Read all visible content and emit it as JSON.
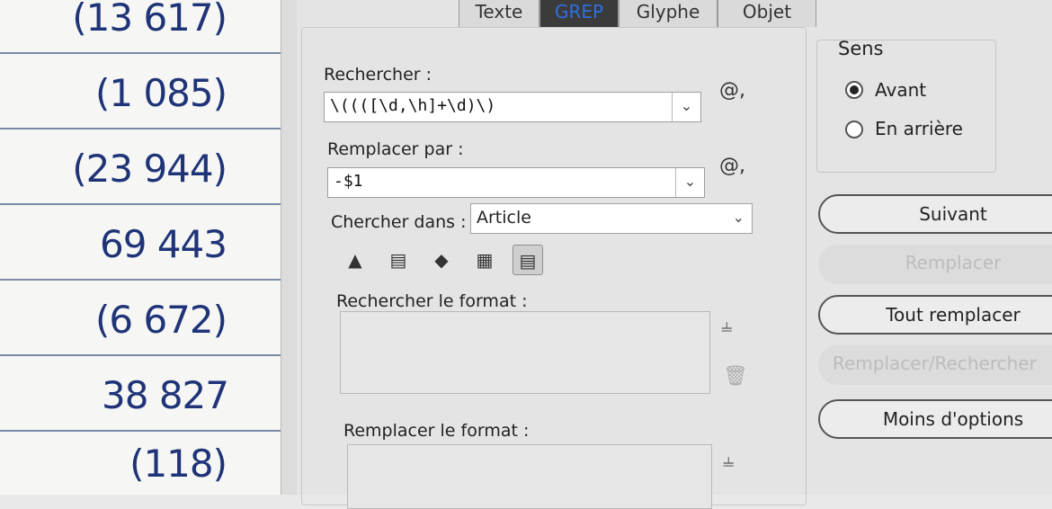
{
  "document": {
    "values": [
      "(13 617)",
      "(1 085)",
      "(23 944)",
      "69 443",
      "(6 672)",
      "38 827",
      "(118)"
    ]
  },
  "tabs": [
    "Texte",
    "GREP",
    "Glyphe",
    "Objet"
  ],
  "active_tab": "GREP",
  "find": {
    "label": "Rechercher :",
    "value": "\\((([\\d,\\h]+\\d)\\)",
    "special_char_icon": "@,"
  },
  "replace": {
    "label": "Remplacer par :",
    "value": "-$1",
    "special_char_icon": "@,"
  },
  "search_in": {
    "label": "Chercher dans :",
    "value": "Article"
  },
  "option_icons": [
    "locked-layers-icon",
    "locked-stories-icon",
    "hidden-layers-icon",
    "master-pages-icon",
    "footnotes-icon"
  ],
  "find_format": {
    "label": "Rechercher le format :"
  },
  "replace_format": {
    "label": "Remplacer le format :"
  },
  "direction": {
    "title": "Sens",
    "forward": "Avant",
    "backward": "En arrière",
    "selected": "forward"
  },
  "buttons": {
    "next": "Suivant",
    "replace": "Remplacer",
    "replace_all": "Tout remplacer",
    "replace_find": "Remplacer/Rechercher",
    "fewer_options": "Moins d'options"
  }
}
